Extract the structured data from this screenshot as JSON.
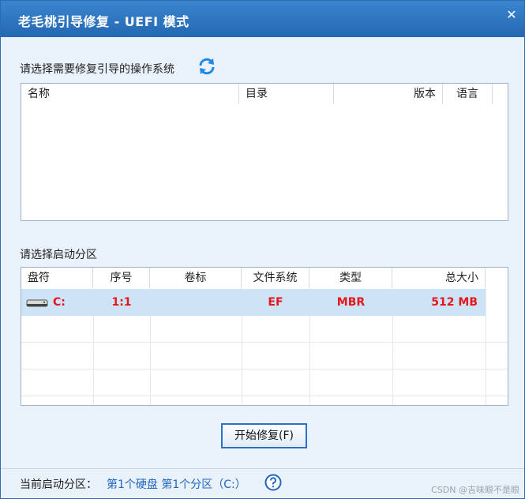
{
  "window": {
    "title": "老毛桃引导修复 - UEFI 模式",
    "close_glyph": "✕"
  },
  "os_section": {
    "label": "请选择需要修复引导的操作系统",
    "columns": [
      "名称",
      "目录",
      "版本",
      "语言"
    ]
  },
  "partition_section": {
    "label": "请选择启动分区",
    "columns": [
      "盘符",
      "序号",
      "卷标",
      "文件系统",
      "类型",
      "总大小"
    ],
    "rows": [
      {
        "drive": "C:",
        "index": "1:1",
        "volume": "",
        "fs": "EF",
        "type": "MBR",
        "size": "512 MB"
      }
    ]
  },
  "actions": {
    "repair_label": "开始修复(F)"
  },
  "status": {
    "label": "当前启动分区：",
    "value": "第1个硬盘 第1个分区（C:）"
  },
  "watermark": "CSDN @吉味眼不是眼",
  "colors": {
    "accent": "#2467b3",
    "selected_row": "#cde4f7",
    "value_red": "#e8161c",
    "link_blue": "#1f66c2"
  },
  "icons": {
    "refresh": "refresh-icon",
    "disk": "disk-icon",
    "help": "help-icon",
    "close": "close-icon"
  }
}
